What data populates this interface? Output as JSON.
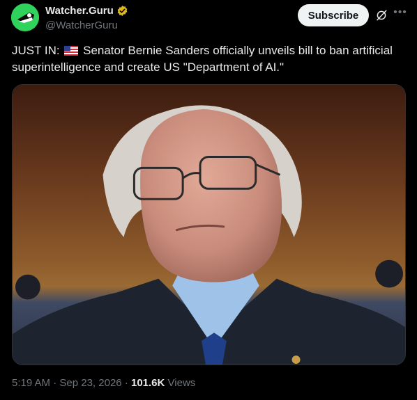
{
  "author": {
    "display_name": "Watcher.Guru",
    "handle": "@WatcherGuru",
    "avatar_icon": "watcher-guru-logo",
    "verified_icon": "gold-verified-badge-icon",
    "brand_color": "#2fd35b"
  },
  "actions": {
    "subscribe_label": "Subscribe",
    "grok_icon": "grok-icon",
    "more_icon": "more-icon"
  },
  "tweet": {
    "prefix": "JUST IN:",
    "flag_icon": "us-flag-icon",
    "body": "Senator Bernie Sanders officially unveils bill to ban artificial superintelligence and create US \"Department of AI.\""
  },
  "media": {
    "type": "photo"
  },
  "meta": {
    "time": "5:19 AM",
    "separator": "·",
    "date": "Sep 23, 2026",
    "views_count": "101.6K",
    "views_label": "Views"
  }
}
